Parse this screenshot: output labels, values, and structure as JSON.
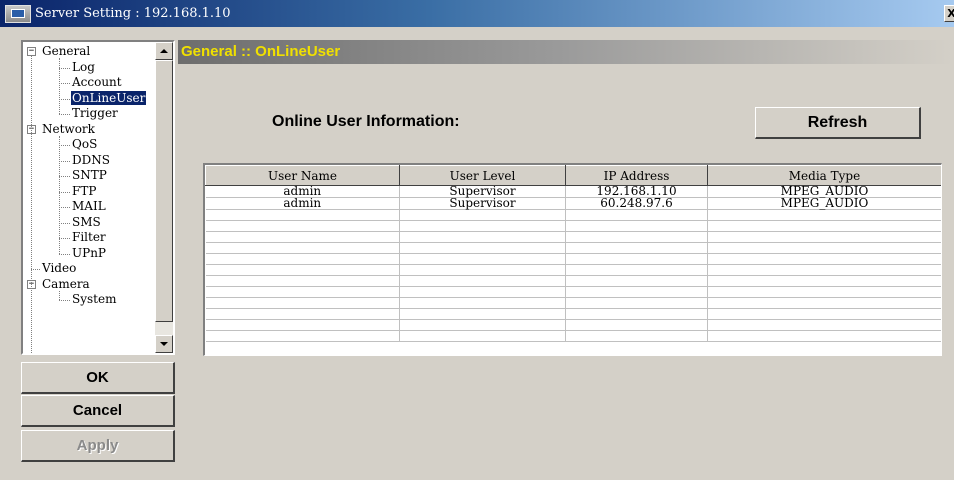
{
  "window": {
    "title": "Server Setting : 192.168.1.10",
    "close_label": "X"
  },
  "tree": {
    "items": [
      {
        "label": "General",
        "level": 0,
        "expander": "−"
      },
      {
        "label": "Log",
        "level": 1
      },
      {
        "label": "Account",
        "level": 1
      },
      {
        "label": "OnLineUser",
        "level": 1,
        "selected": true
      },
      {
        "label": "Trigger",
        "level": 1
      },
      {
        "label": "Network",
        "level": 0,
        "expander": "−"
      },
      {
        "label": "QoS",
        "level": 1
      },
      {
        "label": "DDNS",
        "level": 1
      },
      {
        "label": "SNTP",
        "level": 1
      },
      {
        "label": "FTP",
        "level": 1
      },
      {
        "label": "MAIL",
        "level": 1
      },
      {
        "label": "SMS",
        "level": 1
      },
      {
        "label": "Filter",
        "level": 1
      },
      {
        "label": "UPnP",
        "level": 1
      },
      {
        "label": "Video",
        "level": 0
      },
      {
        "label": "Camera",
        "level": 0,
        "expander": "−"
      },
      {
        "label": "System",
        "level": 1
      }
    ]
  },
  "buttons": {
    "ok": "OK",
    "cancel": "Cancel",
    "apply": "Apply",
    "refresh": "Refresh"
  },
  "main": {
    "section_title": "General :: OnLineUser",
    "info_label": "Online User Information:"
  },
  "table": {
    "columns": [
      "User Name",
      "User Level",
      "IP Address",
      "Media Type"
    ],
    "rows": [
      [
        "admin",
        "Supervisor",
        "192.168.1.10",
        "MPEG_AUDIO"
      ],
      [
        "admin",
        "Supervisor",
        "60.248.97.6",
        "MPEG_AUDIO"
      ]
    ],
    "empty_rows": 12
  },
  "colors": {
    "window_bg": "#d4d0c8",
    "section_title_text": "#f0e000",
    "selection_bg": "#0a246a"
  }
}
